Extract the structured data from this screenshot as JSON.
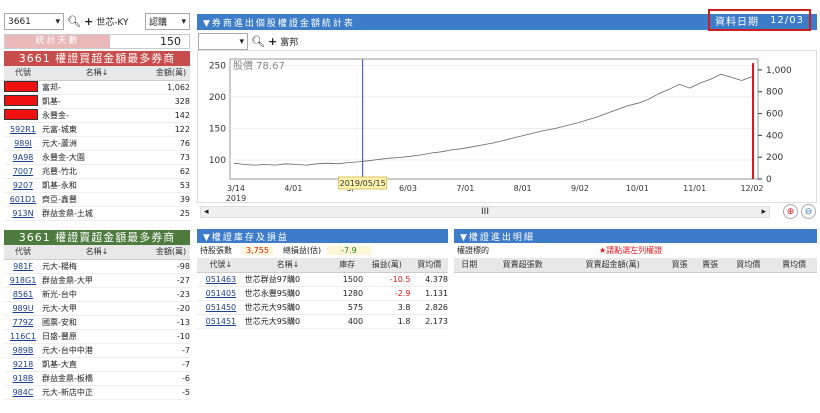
{
  "topbar": {
    "symbol": "3661",
    "stock_name": "世芯-KY",
    "type_select": "認購"
  },
  "days_panel": {
    "label": "統計天數",
    "value": "150"
  },
  "buy_table": {
    "title": "3661 權證買超金額最多券商",
    "col_code": "代號",
    "col_name": "名稱↓",
    "col_amount": "金額(萬)",
    "rows": [
      {
        "code": "",
        "name": "富邦-",
        "amount": "1,062",
        "redacted": true
      },
      {
        "code": "",
        "name": "凱基-",
        "amount": "328",
        "redacted": true
      },
      {
        "code": "",
        "name": "永豐金-",
        "amount": "142",
        "redacted": true
      },
      {
        "code": "592R1",
        "name": "元富-城東",
        "amount": "122"
      },
      {
        "code": "989I",
        "name": "元大-蘆洲",
        "amount": "76"
      },
      {
        "code": "9A98",
        "name": "永豐金-大園",
        "amount": "73"
      },
      {
        "code": "7007",
        "name": "兆豐-竹北",
        "amount": "62"
      },
      {
        "code": "9207",
        "name": "凱基-永和",
        "amount": "53"
      },
      {
        "code": "601D1",
        "name": "齊亞-鑫豐",
        "amount": "39"
      },
      {
        "code": "913N",
        "name": "群益金鼎-土城",
        "amount": "25"
      }
    ]
  },
  "sell_table": {
    "title": "3661 權證賣超金額最多券商",
    "col_code": "代號",
    "col_name": "名稱↓",
    "col_amount": "金額(萬)",
    "rows": [
      {
        "code": "981F",
        "name": "元大-楊梅",
        "amount": "-98"
      },
      {
        "code": "918G1",
        "name": "群益金鼎-大甲",
        "amount": "-27"
      },
      {
        "code": "8561",
        "name": "新光-台中",
        "amount": "-23"
      },
      {
        "code": "989U",
        "name": "元大-大甲",
        "amount": "-20"
      },
      {
        "code": "779Z",
        "name": "國票-安和",
        "amount": "-13"
      },
      {
        "code": "116C1",
        "name": "日盛-豐原",
        "amount": "-10"
      },
      {
        "code": "989B",
        "name": "元大-台中中港",
        "amount": "-7"
      },
      {
        "code": "9218",
        "name": "凱基-大直",
        "amount": "-7"
      },
      {
        "code": "918B",
        "name": "群益金鼎-板橋",
        "amount": "-6"
      },
      {
        "code": "984C",
        "name": "元大-新店中正",
        "amount": "-5"
      }
    ]
  },
  "chart_panel": {
    "title": "▼券商進出個股權證金額統計表",
    "date_label": "資料日期",
    "date_value": "12/03",
    "broker_select": "",
    "broker_name": "富邦",
    "scroll_label": "III"
  },
  "chart_data": {
    "type": "bar",
    "price_label": "股價 78.67",
    "hover_date": "2019/05/15",
    "x_ticks": [
      "3/14\n2019",
      "4/01",
      "5/",
      "6/03",
      "7/01",
      "8/01",
      "9/02",
      "10/01",
      "11/01",
      "12/02"
    ],
    "y_left_ticks": [
      "250",
      "200",
      "150",
      "100"
    ],
    "y_right_ticks": [
      "1,000",
      "800",
      "600",
      "400",
      "200",
      "0"
    ],
    "y_left_range": [
      70,
      260
    ],
    "y_right_range": [
      0,
      1100
    ],
    "bar_series": {
      "name": "",
      "dates": [
        "12/02"
      ],
      "values": [
        1062
      ]
    }
  },
  "inventory": {
    "title": "▼權證庫存及損益",
    "hold_label": "持股張數",
    "hold_value": "3,755",
    "pnl_label": "總損益(估)",
    "pnl_value": "-7.9",
    "columns": [
      "代號↓",
      "名稱↓",
      "庫存",
      "損益(萬)",
      "買均價"
    ],
    "rows": [
      {
        "code": "051463",
        "name": "世芯群益97購0",
        "stock": "1500",
        "pnl": "-10.5",
        "avg": "4.378"
      },
      {
        "code": "051405",
        "name": "世芯永豐9S購0",
        "stock": "1280",
        "pnl": "-2.9",
        "avg": "1.131"
      },
      {
        "code": "051450",
        "name": "世芯元大9S購0",
        "stock": "575",
        "pnl": "3.8",
        "avg": "2.826"
      },
      {
        "code": "051451",
        "name": "世芯元大9S購0",
        "stock": "400",
        "pnl": "1.8",
        "avg": "2.173"
      }
    ]
  },
  "detail": {
    "title": "▼權證進出明細",
    "warrant_label": "權證標的",
    "notice": "★請點選左列權證",
    "columns": [
      "日期",
      "買賣超張數",
      "買賣超金額(萬)",
      "買張",
      "賣張",
      "買均價",
      "賣均價"
    ]
  },
  "colors": {
    "blue_head": "#3d7cc9",
    "buy_head": "#c84c4c",
    "sell_head": "#4d7a3d",
    "highlight_box": "#d11c1c"
  }
}
